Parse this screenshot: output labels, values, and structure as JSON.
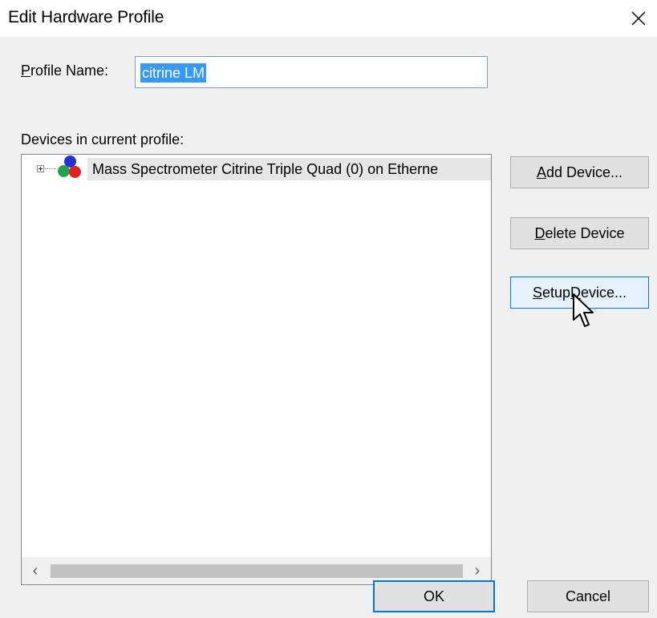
{
  "window": {
    "title": "Edit Hardware Profile"
  },
  "profile": {
    "label_mnemonic": "P",
    "label_rest": "rofile Name:",
    "value": "citrine LM"
  },
  "devices": {
    "label": "Devices in current profile:",
    "items": [
      {
        "label": "Mass Spectrometer Citrine Triple Quad (0) on Etherne"
      }
    ]
  },
  "buttons": {
    "add": {
      "mnemonic": "A",
      "rest": "dd Device..."
    },
    "delete": {
      "mnemonic": "D",
      "rest": "elete Device"
    },
    "setup": {
      "mnemonic": "S",
      "rest_pre": "etup ",
      "mnemonic2": "D",
      "rest_post": "evice..."
    },
    "ok": "OK",
    "cancel": "Cancel"
  },
  "scrollbar": {
    "left_glyph": "‹",
    "right_glyph": "›"
  },
  "icons": {
    "close": "close-icon",
    "device": "device-icon",
    "expand": "expand-icon",
    "cursor": "mouse-cursor-icon"
  },
  "colors": {
    "selection": "#3399ff",
    "focus_border": "#0078d7",
    "dialog_bg": "#f0f0f0"
  }
}
